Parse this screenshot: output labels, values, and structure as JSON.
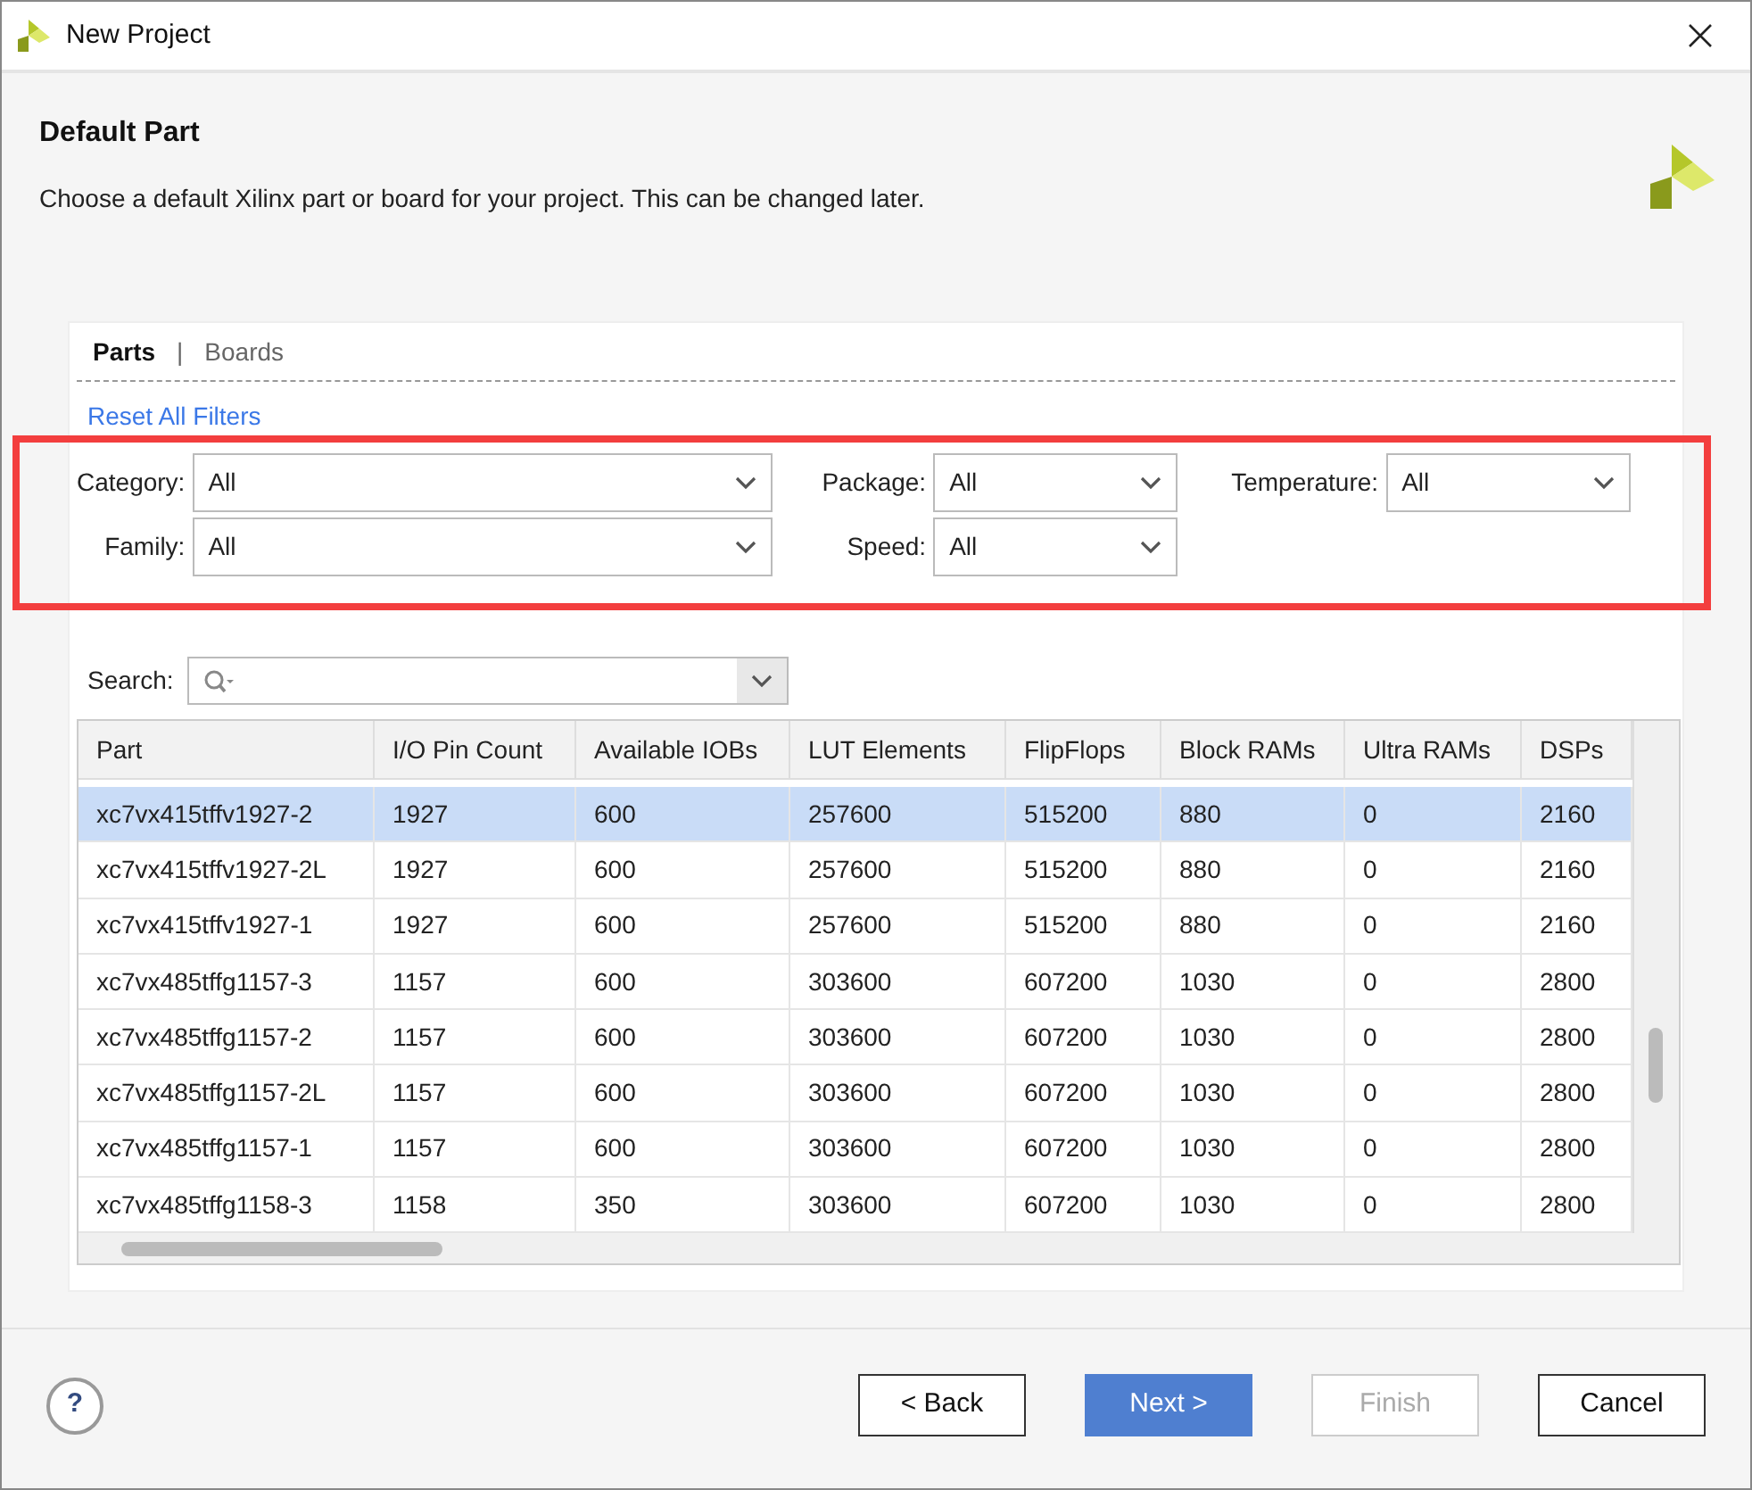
{
  "window": {
    "title": "New Project"
  },
  "header": {
    "title": "Default Part",
    "description": "Choose a default Xilinx part or board for your project. This can be changed later."
  },
  "tabs": [
    {
      "label": "Parts",
      "selected": true
    },
    {
      "label": "Boards",
      "selected": false
    }
  ],
  "separator": "|",
  "reset_link": "Reset All Filters",
  "filters": [
    {
      "label": "Category:",
      "value": "All"
    },
    {
      "label": "Package:",
      "value": "All"
    },
    {
      "label": "Temperature:",
      "value": "All"
    },
    {
      "label": "Family:",
      "value": "All"
    },
    {
      "label": "Speed:",
      "value": "All"
    }
  ],
  "search": {
    "label": "Search:"
  },
  "table": {
    "columns": [
      "Part",
      "I/O Pin Count",
      "Available IOBs",
      "LUT Elements",
      "FlipFlops",
      "Block RAMs",
      "Ultra RAMs",
      "DSPs"
    ],
    "rows": [
      {
        "selected": true,
        "cells": [
          "xc7vx415tffv1927-2",
          "1927",
          "600",
          "257600",
          "515200",
          "880",
          "0",
          "2160"
        ]
      },
      {
        "selected": false,
        "cells": [
          "xc7vx415tffv1927-2L",
          "1927",
          "600",
          "257600",
          "515200",
          "880",
          "0",
          "2160"
        ]
      },
      {
        "selected": false,
        "cells": [
          "xc7vx415tffv1927-1",
          "1927",
          "600",
          "257600",
          "515200",
          "880",
          "0",
          "2160"
        ]
      },
      {
        "selected": false,
        "cells": [
          "xc7vx485tffg1157-3",
          "1157",
          "600",
          "303600",
          "607200",
          "1030",
          "0",
          "2800"
        ]
      },
      {
        "selected": false,
        "cells": [
          "xc7vx485tffg1157-2",
          "1157",
          "600",
          "303600",
          "607200",
          "1030",
          "0",
          "2800"
        ]
      },
      {
        "selected": false,
        "cells": [
          "xc7vx485tffg1157-2L",
          "1157",
          "600",
          "303600",
          "607200",
          "1030",
          "0",
          "2800"
        ]
      },
      {
        "selected": false,
        "cells": [
          "xc7vx485tffg1157-1",
          "1157",
          "600",
          "303600",
          "607200",
          "1030",
          "0",
          "2800"
        ]
      },
      {
        "selected": false,
        "cells": [
          "xc7vx485tffg1158-3",
          "1158",
          "350",
          "303600",
          "607200",
          "1030",
          "0",
          "2800"
        ]
      }
    ]
  },
  "help": "?",
  "buttons": [
    {
      "label": "< Back",
      "kind": "normal"
    },
    {
      "label": "Next >",
      "kind": "primary"
    },
    {
      "label": "Finish",
      "kind": "disabled"
    },
    {
      "label": "Cancel",
      "kind": "normal"
    }
  ]
}
